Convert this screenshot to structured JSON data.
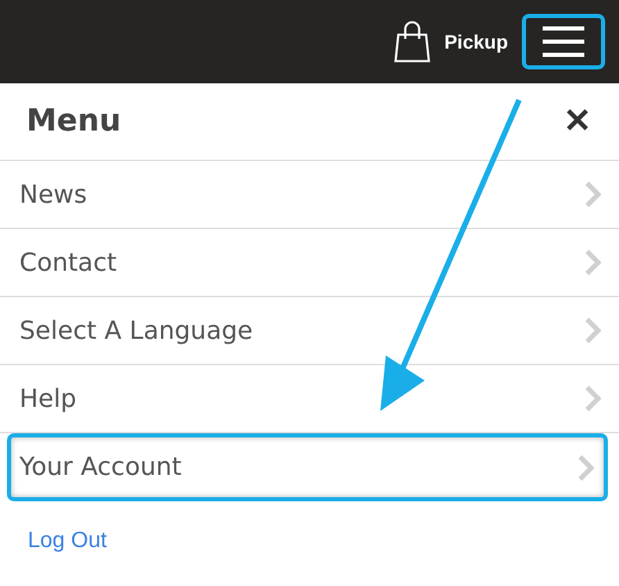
{
  "top_bar": {
    "pickup_label": "Pickup",
    "menu_button_highlighted": true
  },
  "menu": {
    "title": "Menu",
    "close": "✕",
    "items": [
      {
        "label": "News",
        "highlighted": false
      },
      {
        "label": "Contact",
        "highlighted": false
      },
      {
        "label": "Select A Language",
        "highlighted": false
      },
      {
        "label": "Help",
        "highlighted": false
      },
      {
        "label": "Your Account",
        "highlighted": true
      }
    ],
    "logout": "Log Out"
  }
}
